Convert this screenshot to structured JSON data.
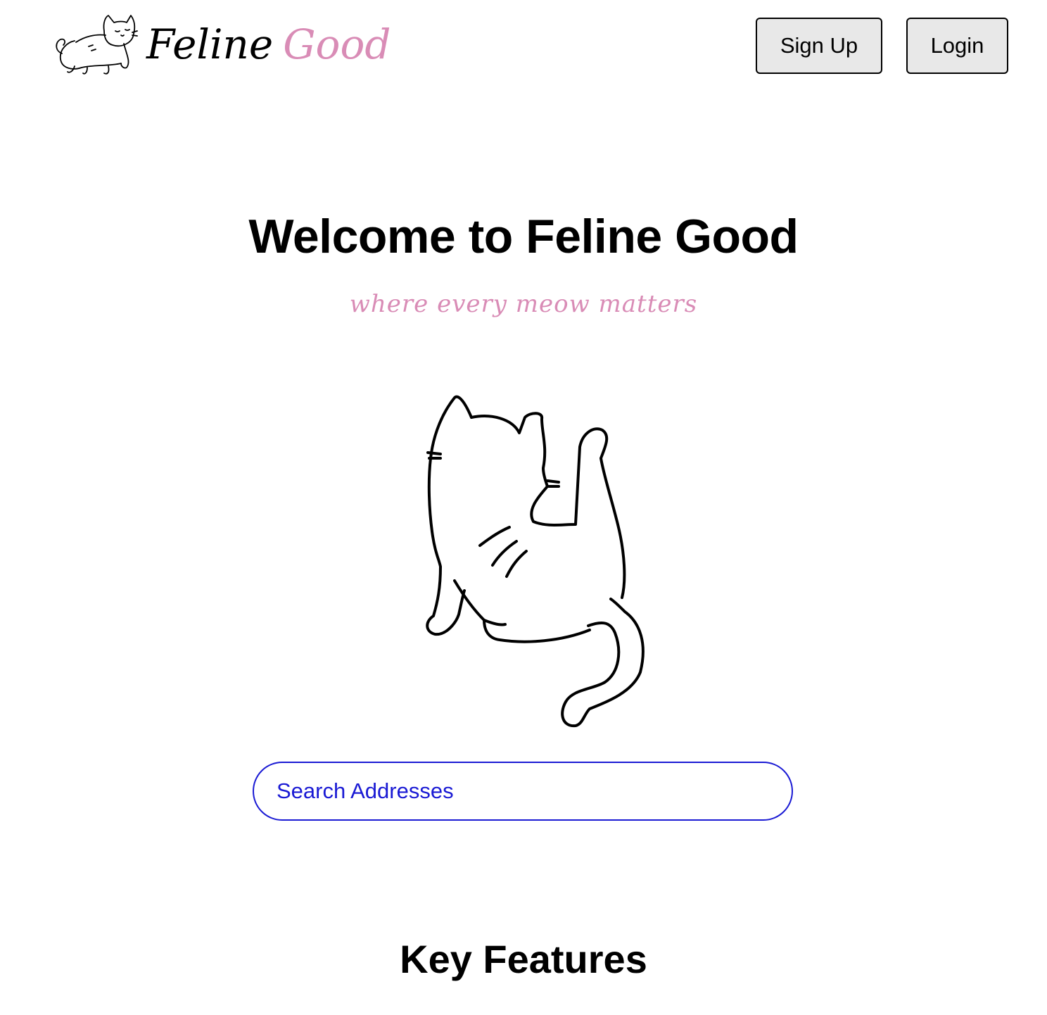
{
  "brand": {
    "name_part1": "Feline",
    "name_part2": "Good",
    "logo_icon": "walking-cat-icon"
  },
  "nav": {
    "signup_label": "Sign Up",
    "login_label": "Login"
  },
  "hero": {
    "title": "Welcome to Feline Good",
    "tagline": "where every meow matters",
    "illustration": "sitting-cat-back-icon"
  },
  "search": {
    "placeholder": "Search Addresses",
    "value": ""
  },
  "features": {
    "heading": "Key Features"
  },
  "colors": {
    "accent_pink": "#d98cb6",
    "search_blue": "#1a1ad4",
    "button_bg": "#e8e8e8",
    "text": "#000000",
    "background": "#ffffff"
  }
}
